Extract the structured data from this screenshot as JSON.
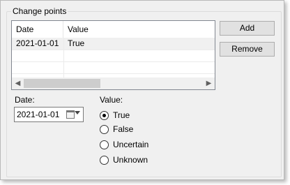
{
  "group": {
    "title": "Change points"
  },
  "list": {
    "columns": [
      "Date",
      "Value"
    ],
    "rows": [
      {
        "date": "2021-01-01",
        "value": "True"
      }
    ]
  },
  "buttons": {
    "add": "Add",
    "remove": "Remove"
  },
  "date_field": {
    "label": "Date:",
    "value": "2021-01-01"
  },
  "value_group": {
    "label": "Value:",
    "options": [
      "True",
      "False",
      "Uncertain",
      "Unknown"
    ],
    "selected": "True"
  }
}
